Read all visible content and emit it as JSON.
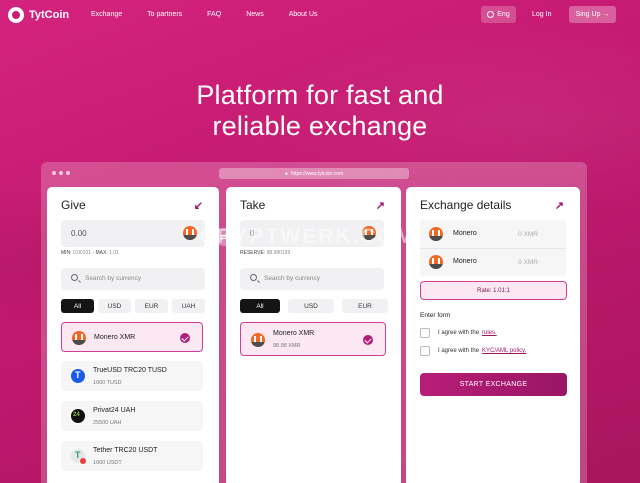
{
  "brand": {
    "name": "TytCoin"
  },
  "nav": {
    "links": [
      "Exchange",
      "To partners",
      "FAQ",
      "News",
      "About Us"
    ],
    "lang": "Eng",
    "login": "Log In",
    "signup": "Sing Up →"
  },
  "hero": {
    "line1": "Platform for fast and",
    "line2": "reliable exchange"
  },
  "browser": {
    "url": "https://www.tytcoin.com"
  },
  "give": {
    "title": "Give",
    "amount_placeholder": "0.00",
    "min_label": "MIN:",
    "min_value": "0.00101",
    "max_label": "MAX:",
    "max_value": "1.01",
    "search_placeholder": "Search by currency",
    "filters": [
      "All",
      "USD",
      "EUR",
      "UAH"
    ],
    "currencies": [
      {
        "name": "Monero XMR",
        "sub": "",
        "icon": "monero-icon"
      },
      {
        "name": "TrueUSD TRC20 TUSD",
        "sub": "1000 TUSD",
        "icon": "trueusd-icon"
      },
      {
        "name": "Privat24 UAH",
        "sub": "25500 UAH",
        "icon": "privat24-icon"
      },
      {
        "name": "Tether TRC20 USDT",
        "sub": "1000 USDT",
        "icon": "tether-icon"
      }
    ]
  },
  "take": {
    "title": "Take",
    "amount_value": "0",
    "reserve_label": "RESERVE:",
    "reserve_value": "98.980199",
    "search_placeholder": "Search by currency",
    "filters": [
      "All",
      "USD",
      "EUR"
    ],
    "selected": {
      "name": "Monero XMR",
      "sub": "98.98 XMR"
    }
  },
  "details": {
    "title": "Exchange details",
    "rows": [
      {
        "name": "Monero",
        "value": "0 XMR"
      },
      {
        "name": "Monero",
        "value": "0 XMR"
      }
    ],
    "rate": "Rate: 1.01:1",
    "form_label": "Enter form",
    "agree1_text": "I agree with the",
    "agree1_link": "rules.",
    "agree2_text": "I agree with the",
    "agree2_link": "KYC/AML policy.",
    "start_button": "START EXCHANGE"
  },
  "watermark": "CRYPTWERK.COM",
  "colors": {
    "accent": "#c81e74",
    "selected_bg": "#fbe8f3",
    "button": "#b81e78"
  }
}
